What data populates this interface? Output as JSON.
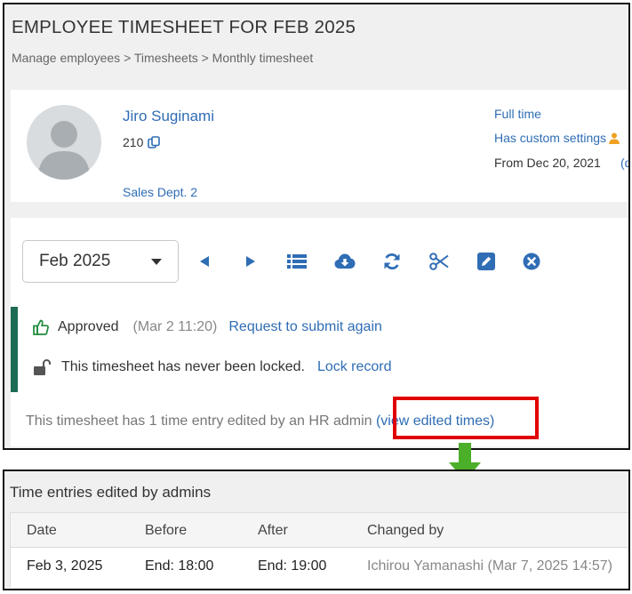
{
  "header": {
    "title": "EMPLOYEE TIMESHEET FOR FEB 2025",
    "breadcrumb": "Manage employees > Timesheets > Monthly timesheet"
  },
  "employee": {
    "name": "Jiro Suginami",
    "id": "210",
    "department": "Sales Dept. 2",
    "employment_type": "Full time",
    "custom_settings": "Has custom settings",
    "from_date": "From Dec 20, 2021",
    "extra_link": "(de"
  },
  "toolbar": {
    "month_value": "Feb 2025",
    "icons": [
      "prev-month-icon",
      "next-month-icon",
      "list-view-icon",
      "download-icon",
      "refresh-icon",
      "cut-icon",
      "edit-icon",
      "close-icon"
    ]
  },
  "status": {
    "approved_label": "Approved",
    "approved_meta": "(Mar 2  11:20)",
    "approved_link": "Request to submit again",
    "locked_text": "This timesheet has never been locked.",
    "locked_link": "Lock record"
  },
  "edited_notice": {
    "text": "This timesheet has 1 time entry edited by an HR admin",
    "link": "(view edited times)"
  },
  "edits_panel": {
    "title": "Time entries edited by admins",
    "columns": [
      "Date",
      "Before",
      "After",
      "Changed by"
    ],
    "rows": [
      {
        "date": "Feb 3, 2025",
        "before": "End: 18:00",
        "after": "End: 19:00",
        "changed_by": "Ichirou Yamanashi (Mar 7, 2025 14:57)"
      }
    ]
  },
  "colors": {
    "link": "#2f6db5",
    "status_bar": "#1d6b55",
    "highlight": "#e00000",
    "arrow": "#4caf2a"
  }
}
